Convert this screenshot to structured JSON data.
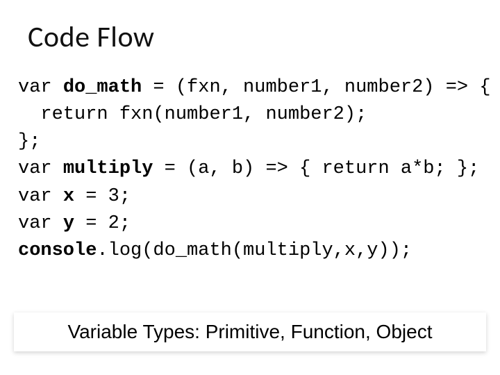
{
  "title": "Code Flow",
  "code": {
    "l1a": "var ",
    "l1b": "do_math",
    "l1c": " = (fxn, number1, number2) => {",
    "l2": "  return fxn(number1, number2);",
    "l3": "};",
    "l4a": "var ",
    "l4b": "multiply",
    "l4c": " = (a, b) => { return a*b; };",
    "l5a": "var ",
    "l5b": "x",
    "l5c": " = 3;",
    "l6a": "var ",
    "l6b": "y",
    "l6c": " = 2;",
    "l7a": "console",
    "l7b": ".log(do_math(multiply,x,y));"
  },
  "footer": "Variable Types: Primitive, Function, Object"
}
